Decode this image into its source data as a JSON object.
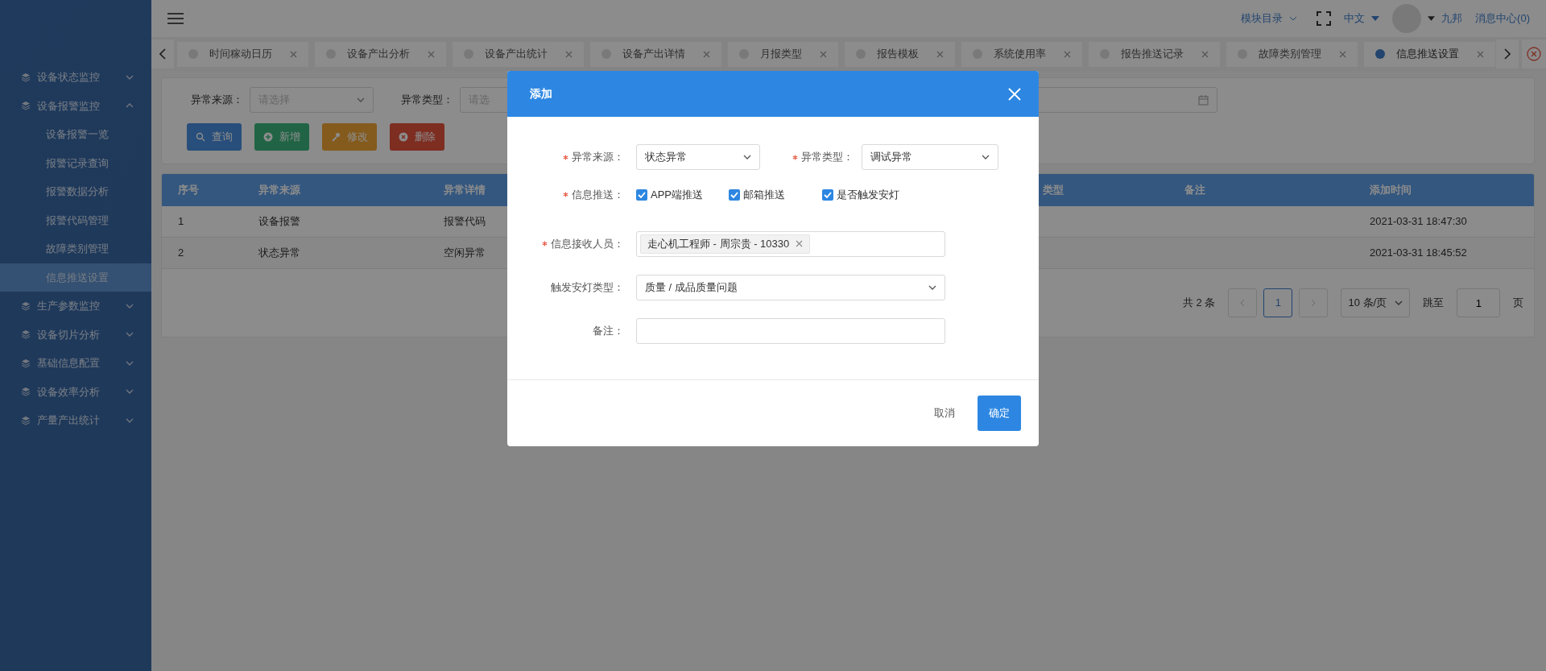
{
  "topbar": {
    "module_menu": "模块目录",
    "language": "中文",
    "user": "九邦",
    "messages": "消息中心(0)"
  },
  "tabs": [
    {
      "label": "时间稼动日历",
      "selected": false
    },
    {
      "label": "设备产出分析",
      "selected": false
    },
    {
      "label": "设备产出统计",
      "selected": false
    },
    {
      "label": "设备产出详情",
      "selected": false
    },
    {
      "label": "月报类型",
      "selected": false
    },
    {
      "label": "报告模板",
      "selected": false
    },
    {
      "label": "系统使用率",
      "selected": false
    },
    {
      "label": "报告推送记录",
      "selected": false
    },
    {
      "label": "故障类别管理",
      "selected": false
    },
    {
      "label": "信息推送设置",
      "selected": true
    }
  ],
  "sidebar": {
    "items": [
      {
        "label": "设备状态监控",
        "expanded": false,
        "selected": false
      },
      {
        "label": "设备报警监控",
        "expanded": true,
        "selected": false,
        "children": [
          {
            "label": "设备报警一览",
            "selected": false
          },
          {
            "label": "报警记录查询",
            "selected": false
          },
          {
            "label": "报警数据分析",
            "selected": false
          },
          {
            "label": "报警代码管理",
            "selected": false
          },
          {
            "label": "故障类别管理",
            "selected": false
          },
          {
            "label": "信息推送设置",
            "selected": true
          }
        ]
      },
      {
        "label": "生产参数监控",
        "expanded": false,
        "selected": false
      },
      {
        "label": "设备切片分析",
        "expanded": false,
        "selected": false
      },
      {
        "label": "基础信息配置",
        "expanded": false,
        "selected": false
      },
      {
        "label": "设备效率分析",
        "expanded": false,
        "selected": false
      },
      {
        "label": "产量产出统计",
        "expanded": false,
        "selected": false
      }
    ]
  },
  "filters": [
    {
      "label": "异常来源：",
      "placeholder": "请选择"
    },
    {
      "label": "异常类型：",
      "placeholder": "请选"
    }
  ],
  "toolbar": [
    {
      "label": "查询",
      "kind": "search"
    },
    {
      "label": "新增",
      "kind": "add"
    },
    {
      "label": "修改",
      "kind": "edit"
    },
    {
      "label": "删除",
      "kind": "delete"
    }
  ],
  "table": {
    "columns": [
      "序号",
      "异常来源",
      "异常详情",
      "类型",
      "备注",
      "添加时间"
    ],
    "rows": [
      [
        "1",
        "设备报警",
        "报警代码",
        null,
        null,
        "2021-03-31 18:47:30"
      ],
      [
        "2",
        "状态异常",
        "空闲异常",
        null,
        null,
        "2021-03-31 18:45:52"
      ]
    ]
  },
  "pagination": {
    "total": "共 2 条",
    "pages": [
      {
        "label": "1",
        "selected": true
      }
    ],
    "page_size": "10 条/页",
    "jump_label": "跳至",
    "jump_value": "1",
    "page_suffix": "页"
  },
  "dialog": {
    "title": "添加",
    "rows": [
      [
        {
          "label": "异常来源：",
          "required": true,
          "kind": "select",
          "value": "状态异常"
        },
        {
          "label": "异常类型：",
          "required": true,
          "kind": "select",
          "value": "调试异常"
        }
      ],
      [
        {
          "label": "信息推送：",
          "required": true,
          "kind": "checkboxes",
          "options": [
            {
              "label": "APP端推送",
              "checked": true
            },
            {
              "label": "邮箱推送",
              "checked": true
            },
            {
              "label": "是否触发安灯",
              "checked": true
            }
          ]
        }
      ],
      [
        {
          "label": "信息接收人员：",
          "required": true,
          "kind": "tags",
          "tags": [
            "走心机工程师 - 周宗贵 - 10330"
          ]
        }
      ],
      [
        {
          "label": "触发安灯类型：",
          "required": false,
          "kind": "select",
          "value": "质量 / 成品质量问题"
        }
      ],
      [
        {
          "label": "备注：",
          "required": false,
          "kind": "input"
        }
      ]
    ],
    "buttons": [
      {
        "label": "取消",
        "kind": "secondary"
      },
      {
        "label": "确定",
        "kind": "primary"
      }
    ]
  }
}
